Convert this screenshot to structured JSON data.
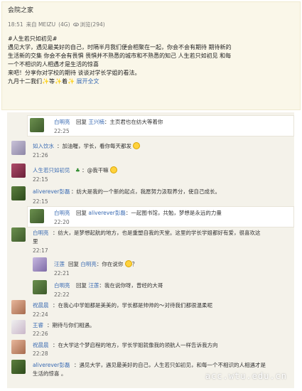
{
  "post": {
    "title": "会院之家",
    "time": "18:51",
    "source": "来自 MEIZU",
    "network": "(4G)",
    "views_label": "浏览(294)",
    "lines": [
      "#人生若只如初见#",
      "遇见大学，遇见最美好的自己，时隔半月我们便会相聚在一起，你会不会有期待 期待新的",
      "生活新的交集 你会不会有畏惧 畏惧并不熟悉的城市和不熟悉的知己 人生若只如初见 和每",
      "一个不相识的人相遇才是生活的惊喜",
      "来吧！分享你对学校的期待 谈谈对学长学姐的看法。"
    ],
    "last_line_prefix": "九月十二我们",
    "last_line_mid1": "等",
    "last_line_mid2": "着",
    "expand_label": "展开全文"
  },
  "comments": [
    {
      "name": "白明亮",
      "reply_word": "回复",
      "reply_to": "王兴楠",
      "text": "：主页君也在纺大等着你",
      "time": "22:25"
    },
    {
      "name": "如入饮水",
      "text": "：加油喔，学长，看你每天都发",
      "time": "21:26"
    },
    {
      "name": "人生若只如初见",
      "text": "：@我干嘛",
      "time": "22:15"
    },
    {
      "name": "aliverever彭磊",
      "text": "：纺大是我的一个新的起点，我愿努力汲取养分，使自己成长。",
      "time": "22:15"
    },
    {
      "name": "白明亮",
      "reply_word": "回复",
      "reply_to": "aliverever彭磊",
      "text": "：一起图书馆，共勉，梦想是永远的力量",
      "time": "22:20"
    },
    {
      "name": "白明亮",
      "text": "：纺大，是梦想起航的地方，也是重塑自我的天堂。这里的学长学姐都好有爱，很喜欢这",
      "text2": "里",
      "time": "22:17"
    },
    {
      "name": "汪莲",
      "reply_word": "回复",
      "reply_to": "白明亮",
      "text": "：你在说你",
      "text_end": "？",
      "time": "22:21"
    },
    {
      "name": "白明亮",
      "reply_word": "回复",
      "reply_to": "汪莲",
      "text": "：我在说你呀，曾经的大哥",
      "time": "22:22"
    },
    {
      "name": "祝晨晨",
      "text": "：在我心中学姐都是美美的，学长都是帅帅的～对待我们都很温柔呢",
      "time": "22:24"
    },
    {
      "name": "王睿",
      "text": "：期待与你们相遇。",
      "time": "22:26"
    },
    {
      "name": "祝晨晨",
      "text": "：在大学这个梦启程的地方，学长学姐就像我的领航人一样告诉我方向",
      "time": "22:28"
    },
    {
      "name": "aliverever彭磊",
      "text": "：遇见大学，遇见最美好的自己，人生若只如初见，和每一个不相识的人相遇才是",
      "text2": "生活的惊喜 。",
      "time": ""
    }
  ],
  "watermark": "acc.wtu.edu.cn",
  "colors": {
    "link": "#3a6bb3",
    "post_bg": "#faf7e9",
    "comments_bg": "#f4f2ea"
  }
}
